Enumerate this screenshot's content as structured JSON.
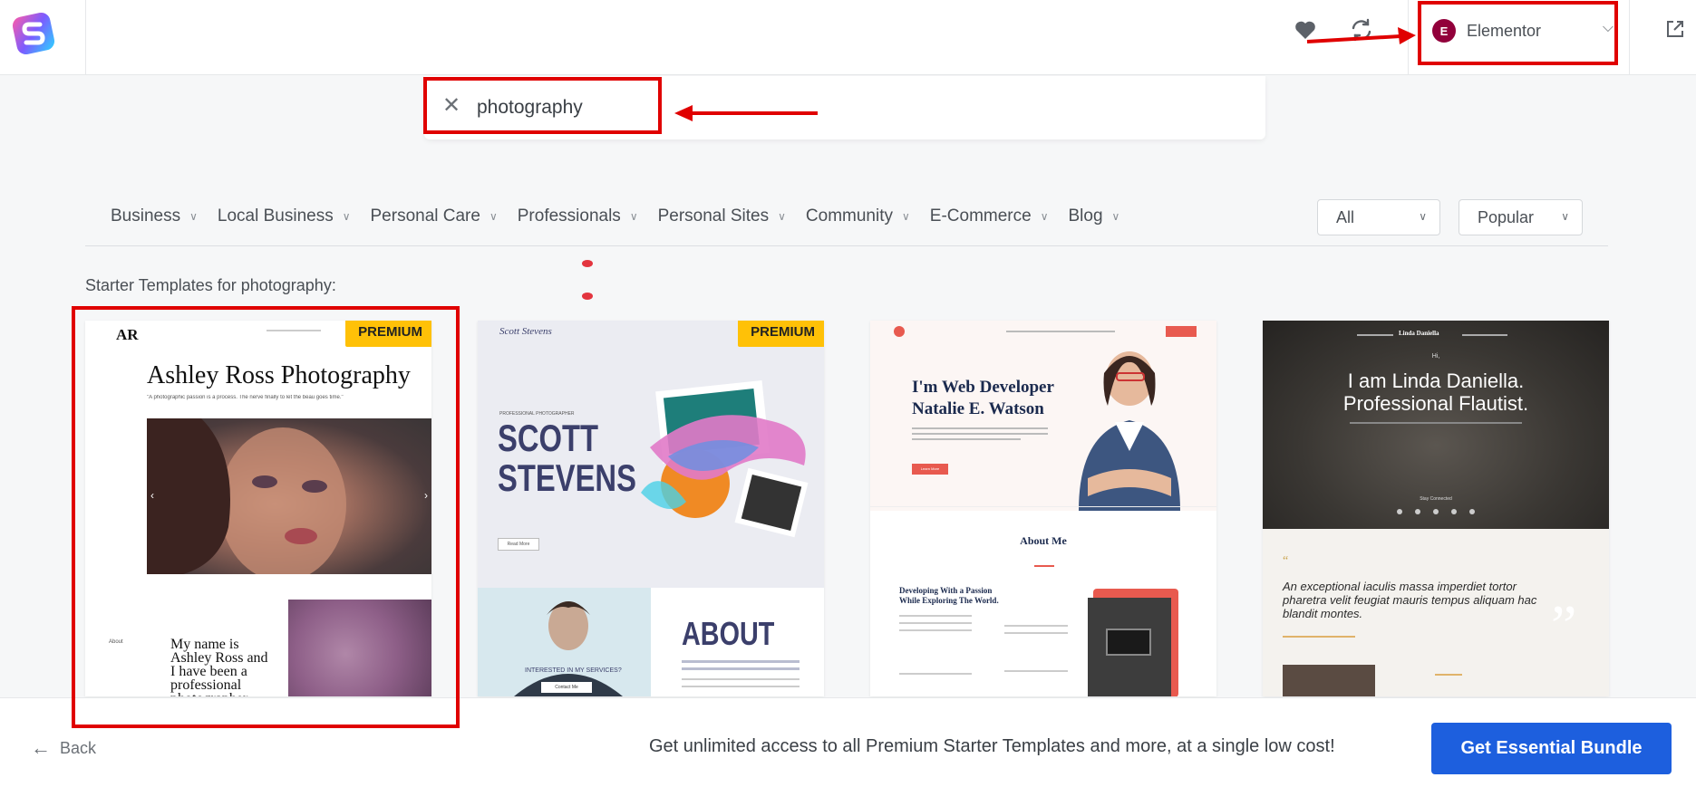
{
  "header": {
    "builder_label": "Elementor",
    "builder_badge": "E"
  },
  "search": {
    "value": "photography",
    "placeholder": ""
  },
  "categories": [
    {
      "label": "Business"
    },
    {
      "label": "Local Business"
    },
    {
      "label": "Personal Care"
    },
    {
      "label": "Professionals"
    },
    {
      "label": "Personal Sites"
    },
    {
      "label": "Community"
    },
    {
      "label": "E-Commerce"
    },
    {
      "label": "Blog"
    }
  ],
  "filters": {
    "type_selected": "All",
    "sort_selected": "Popular"
  },
  "results_label": "Starter Templates for photography:",
  "cards": [
    {
      "premium": "PREMIUM",
      "logo": "AR",
      "title": "Ashley Ross Photography",
      "tagline": "\"A photographic passion is a process. The nerve finally to let the beau goes time.\"",
      "about_nav": "About",
      "body": "My name is Ashley Ross and I have been a professional photographer"
    },
    {
      "premium": "PREMIUM",
      "logo": "Scott Stevens",
      "kicker": "PROFESSIONAL PHOTOGRAPHER",
      "name_line1": "SCOTT",
      "name_line2": "STEVENS",
      "button": "Read More",
      "about": "ABOUT",
      "services": "INTERESTED IN MY SERVICES?",
      "contact": "Contact Me"
    },
    {
      "hero_line1": "I'm Web Developer",
      "hero_line2": "Natalie E. Watson",
      "cta": "Learn More",
      "about": "About Me",
      "subhead_line1": "Developing With a Passion",
      "subhead_line2": "While Exploring The World."
    },
    {
      "hi": "Hi,",
      "hero_line1": "I am Linda Daniella.",
      "hero_line2": "Professional Flautist.",
      "connected": "Stay Connected",
      "brand": "Linda Daniella",
      "quote": "An exceptional iaculis massa imperdiet tortor pharetra velit feugiat mauris tempus aliquam hac blandit montes."
    }
  ],
  "bottom": {
    "back_label": "Back",
    "promo": "Get unlimited access to all Premium Starter Templates and more, at a single low cost!",
    "cta_label": "Get Essential Bundle"
  },
  "colors": {
    "accent_blue": "#1d5fde",
    "premium_yellow": "#ffc107",
    "annotation_red": "#e00000",
    "elementor": "#92003b"
  }
}
